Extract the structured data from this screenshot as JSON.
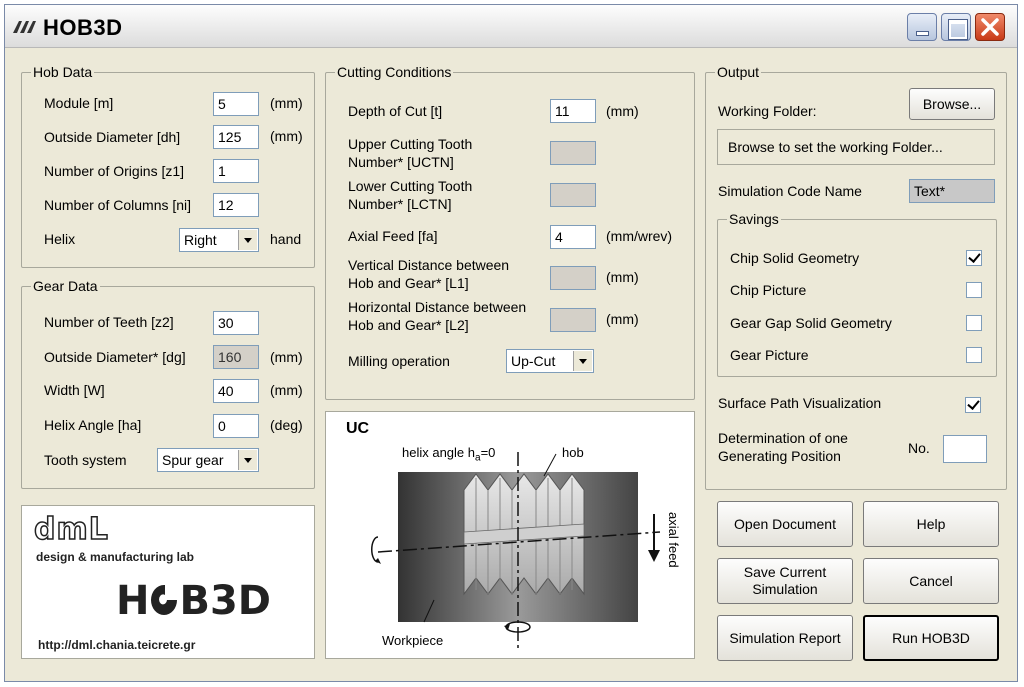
{
  "window": {
    "title": "HOB3D"
  },
  "hob_data": {
    "legend": "Hob Data",
    "module_label": "Module [m]",
    "module_value": "5",
    "module_unit": "(mm)",
    "outside_diameter_label": "Outside Diameter [dh]",
    "outside_diameter_value": "125",
    "outside_diameter_unit": "(mm)",
    "origins_label": "Number of Origins [z1]",
    "origins_value": "1",
    "columns_label": "Number of Columns [ni]",
    "columns_value": "12",
    "helix_label": "Helix",
    "helix_value": "Right",
    "helix_unit": "hand"
  },
  "gear_data": {
    "legend": "Gear Data",
    "teeth_label": "Number of Teeth [z2]",
    "teeth_value": "30",
    "diameter_label": "Outside Diameter* [dg]",
    "diameter_value": "160",
    "diameter_unit": "(mm)",
    "width_label": "Width [W]",
    "width_value": "40",
    "width_unit": "(mm)",
    "helix_angle_label": "Helix Angle [ha]",
    "helix_angle_value": "0",
    "helix_angle_unit": "(deg)",
    "tooth_system_label": "Tooth system",
    "tooth_system_value": "Spur gear"
  },
  "cutting": {
    "legend": "Cutting Conditions",
    "depth_label": "Depth of Cut [t]",
    "depth_value": "11",
    "depth_unit": "(mm)",
    "uctn_label_1": "Upper Cutting Tooth",
    "uctn_label_2": "Number* [UCTN]",
    "lctn_label_1": "Lower Cutting Tooth",
    "lctn_label_2": "Number* [LCTN]",
    "feed_label": "Axial Feed [fa]",
    "feed_value": "4",
    "feed_unit": "(mm/wrev)",
    "l1_label_1": "Vertical Distance between",
    "l1_label_2": "Hob and Gear* [L1]",
    "l1_unit": "(mm)",
    "l2_label_1": "Horizontal Distance between",
    "l2_label_2": "Hob and Gear* [L2]",
    "l2_unit": "(mm)",
    "milling_label": "Milling operation",
    "milling_value": "Up-Cut"
  },
  "diagram": {
    "code": "UC",
    "helix_text": "helix angle h",
    "helix_sub": "a",
    "helix_eq": "=0",
    "hob_label": "hob",
    "feed_label": "axial feed",
    "workpiece_label": "Workpiece"
  },
  "logo": {
    "dml": "dmL",
    "subtitle": "design & manufacturing lab",
    "product_left": "H",
    "product_right": "B3D",
    "url": "http://dml.chania.teicrete.gr"
  },
  "output": {
    "legend": "Output",
    "folder_label": "Working Folder:",
    "browse_label": "Browse...",
    "folder_value": "Browse to set the working Folder...",
    "code_name_label": "Simulation Code Name",
    "code_name_value": "Text*",
    "savings": {
      "legend": "Savings",
      "items": [
        {
          "label": "Chip Solid Geometry",
          "checked": true
        },
        {
          "label": "Chip Picture",
          "checked": false
        },
        {
          "label": "Gear Gap Solid Geometry",
          "checked": false
        },
        {
          "label": "Gear Picture",
          "checked": false
        }
      ]
    },
    "surface_label": "Surface Path Visualization",
    "surface_checked": true,
    "gen_label_1": "Determination of one",
    "gen_label_2": "Generating Position",
    "no_label": "No.",
    "no_value": ""
  },
  "buttons": {
    "open_document": "Open Document",
    "help": "Help",
    "save_1": "Save  Current",
    "save_2": "Simulation",
    "cancel": "Cancel",
    "report": "Simulation Report",
    "run": "Run HOB3D"
  }
}
